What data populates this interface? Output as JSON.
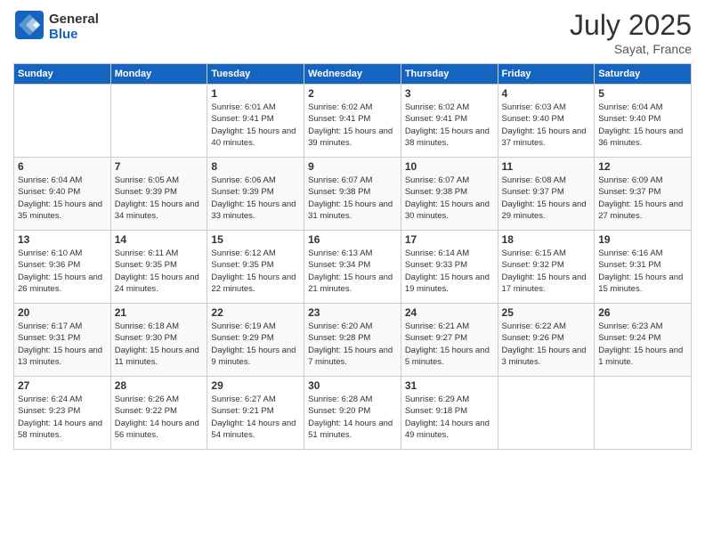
{
  "header": {
    "logo_general": "General",
    "logo_blue": "Blue",
    "month_title": "July 2025",
    "subtitle": "Sayat, France"
  },
  "days_of_week": [
    "Sunday",
    "Monday",
    "Tuesday",
    "Wednesday",
    "Thursday",
    "Friday",
    "Saturday"
  ],
  "weeks": [
    [
      {
        "day": "",
        "info": ""
      },
      {
        "day": "",
        "info": ""
      },
      {
        "day": "1",
        "info": "Sunrise: 6:01 AM\nSunset: 9:41 PM\nDaylight: 15 hours and 40 minutes."
      },
      {
        "day": "2",
        "info": "Sunrise: 6:02 AM\nSunset: 9:41 PM\nDaylight: 15 hours and 39 minutes."
      },
      {
        "day": "3",
        "info": "Sunrise: 6:02 AM\nSunset: 9:41 PM\nDaylight: 15 hours and 38 minutes."
      },
      {
        "day": "4",
        "info": "Sunrise: 6:03 AM\nSunset: 9:40 PM\nDaylight: 15 hours and 37 minutes."
      },
      {
        "day": "5",
        "info": "Sunrise: 6:04 AM\nSunset: 9:40 PM\nDaylight: 15 hours and 36 minutes."
      }
    ],
    [
      {
        "day": "6",
        "info": "Sunrise: 6:04 AM\nSunset: 9:40 PM\nDaylight: 15 hours and 35 minutes."
      },
      {
        "day": "7",
        "info": "Sunrise: 6:05 AM\nSunset: 9:39 PM\nDaylight: 15 hours and 34 minutes."
      },
      {
        "day": "8",
        "info": "Sunrise: 6:06 AM\nSunset: 9:39 PM\nDaylight: 15 hours and 33 minutes."
      },
      {
        "day": "9",
        "info": "Sunrise: 6:07 AM\nSunset: 9:38 PM\nDaylight: 15 hours and 31 minutes."
      },
      {
        "day": "10",
        "info": "Sunrise: 6:07 AM\nSunset: 9:38 PM\nDaylight: 15 hours and 30 minutes."
      },
      {
        "day": "11",
        "info": "Sunrise: 6:08 AM\nSunset: 9:37 PM\nDaylight: 15 hours and 29 minutes."
      },
      {
        "day": "12",
        "info": "Sunrise: 6:09 AM\nSunset: 9:37 PM\nDaylight: 15 hours and 27 minutes."
      }
    ],
    [
      {
        "day": "13",
        "info": "Sunrise: 6:10 AM\nSunset: 9:36 PM\nDaylight: 15 hours and 26 minutes."
      },
      {
        "day": "14",
        "info": "Sunrise: 6:11 AM\nSunset: 9:35 PM\nDaylight: 15 hours and 24 minutes."
      },
      {
        "day": "15",
        "info": "Sunrise: 6:12 AM\nSunset: 9:35 PM\nDaylight: 15 hours and 22 minutes."
      },
      {
        "day": "16",
        "info": "Sunrise: 6:13 AM\nSunset: 9:34 PM\nDaylight: 15 hours and 21 minutes."
      },
      {
        "day": "17",
        "info": "Sunrise: 6:14 AM\nSunset: 9:33 PM\nDaylight: 15 hours and 19 minutes."
      },
      {
        "day": "18",
        "info": "Sunrise: 6:15 AM\nSunset: 9:32 PM\nDaylight: 15 hours and 17 minutes."
      },
      {
        "day": "19",
        "info": "Sunrise: 6:16 AM\nSunset: 9:31 PM\nDaylight: 15 hours and 15 minutes."
      }
    ],
    [
      {
        "day": "20",
        "info": "Sunrise: 6:17 AM\nSunset: 9:31 PM\nDaylight: 15 hours and 13 minutes."
      },
      {
        "day": "21",
        "info": "Sunrise: 6:18 AM\nSunset: 9:30 PM\nDaylight: 15 hours and 11 minutes."
      },
      {
        "day": "22",
        "info": "Sunrise: 6:19 AM\nSunset: 9:29 PM\nDaylight: 15 hours and 9 minutes."
      },
      {
        "day": "23",
        "info": "Sunrise: 6:20 AM\nSunset: 9:28 PM\nDaylight: 15 hours and 7 minutes."
      },
      {
        "day": "24",
        "info": "Sunrise: 6:21 AM\nSunset: 9:27 PM\nDaylight: 15 hours and 5 minutes."
      },
      {
        "day": "25",
        "info": "Sunrise: 6:22 AM\nSunset: 9:26 PM\nDaylight: 15 hours and 3 minutes."
      },
      {
        "day": "26",
        "info": "Sunrise: 6:23 AM\nSunset: 9:24 PM\nDaylight: 15 hours and 1 minute."
      }
    ],
    [
      {
        "day": "27",
        "info": "Sunrise: 6:24 AM\nSunset: 9:23 PM\nDaylight: 14 hours and 58 minutes."
      },
      {
        "day": "28",
        "info": "Sunrise: 6:26 AM\nSunset: 9:22 PM\nDaylight: 14 hours and 56 minutes."
      },
      {
        "day": "29",
        "info": "Sunrise: 6:27 AM\nSunset: 9:21 PM\nDaylight: 14 hours and 54 minutes."
      },
      {
        "day": "30",
        "info": "Sunrise: 6:28 AM\nSunset: 9:20 PM\nDaylight: 14 hours and 51 minutes."
      },
      {
        "day": "31",
        "info": "Sunrise: 6:29 AM\nSunset: 9:18 PM\nDaylight: 14 hours and 49 minutes."
      },
      {
        "day": "",
        "info": ""
      },
      {
        "day": "",
        "info": ""
      }
    ]
  ]
}
